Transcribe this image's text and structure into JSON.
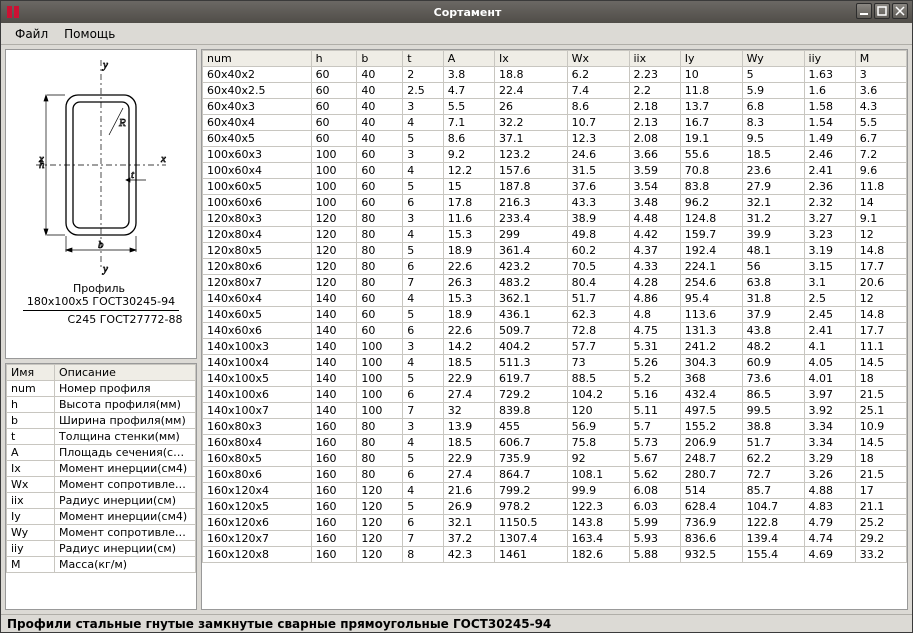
{
  "window": {
    "title": "Сортамент"
  },
  "menu": {
    "file": "Файл",
    "help": "Помощь"
  },
  "profile": {
    "prefix": "Профиль",
    "top_line": "180x100x5 ГОСТ30245-94",
    "bottom_line": "С245 ГОСТ27772-88"
  },
  "legend": {
    "columns": [
      "Имя",
      "Описание"
    ],
    "rows": [
      [
        "num",
        "Номер профиля"
      ],
      [
        "h",
        "Высота профиля(мм)"
      ],
      [
        "b",
        "Ширина профиля(мм)"
      ],
      [
        "t",
        "Толщина стенки(мм)"
      ],
      [
        "A",
        "Площадь сечения(с…"
      ],
      [
        "Ix",
        "Момент инерции(см4)"
      ],
      [
        "Wx",
        "Момент сопротивле…"
      ],
      [
        "iix",
        "Радиус инерции(см)"
      ],
      [
        "Iy",
        "Момент инерции(см4)"
      ],
      [
        "Wy",
        "Момент сопротивле…"
      ],
      [
        "iiy",
        "Радиус инерции(см)"
      ],
      [
        "M",
        "Масса(кг/м)"
      ]
    ]
  },
  "table": {
    "columns": [
      "num",
      "h",
      "b",
      "t",
      "A",
      "Ix",
      "Wx",
      "iix",
      "Iy",
      "Wy",
      "iiy",
      "M"
    ],
    "rows": [
      [
        "60x40x2",
        "60",
        "40",
        "2",
        "3.8",
        "18.8",
        "6.2",
        "2.23",
        "10",
        "5",
        "1.63",
        "3"
      ],
      [
        "60x40x2.5",
        "60",
        "40",
        "2.5",
        "4.7",
        "22.4",
        "7.4",
        "2.2",
        "11.8",
        "5.9",
        "1.6",
        "3.6"
      ],
      [
        "60x40x3",
        "60",
        "40",
        "3",
        "5.5",
        "26",
        "8.6",
        "2.18",
        "13.7",
        "6.8",
        "1.58",
        "4.3"
      ],
      [
        "60x40x4",
        "60",
        "40",
        "4",
        "7.1",
        "32.2",
        "10.7",
        "2.13",
        "16.7",
        "8.3",
        "1.54",
        "5.5"
      ],
      [
        "60x40x5",
        "60",
        "40",
        "5",
        "8.6",
        "37.1",
        "12.3",
        "2.08",
        "19.1",
        "9.5",
        "1.49",
        "6.7"
      ],
      [
        "100x60x3",
        "100",
        "60",
        "3",
        "9.2",
        "123.2",
        "24.6",
        "3.66",
        "55.6",
        "18.5",
        "2.46",
        "7.2"
      ],
      [
        "100x60x4",
        "100",
        "60",
        "4",
        "12.2",
        "157.6",
        "31.5",
        "3.59",
        "70.8",
        "23.6",
        "2.41",
        "9.6"
      ],
      [
        "100x60x5",
        "100",
        "60",
        "5",
        "15",
        "187.8",
        "37.6",
        "3.54",
        "83.8",
        "27.9",
        "2.36",
        "11.8"
      ],
      [
        "100x60x6",
        "100",
        "60",
        "6",
        "17.8",
        "216.3",
        "43.3",
        "3.48",
        "96.2",
        "32.1",
        "2.32",
        "14"
      ],
      [
        "120x80x3",
        "120",
        "80",
        "3",
        "11.6",
        "233.4",
        "38.9",
        "4.48",
        "124.8",
        "31.2",
        "3.27",
        "9.1"
      ],
      [
        "120x80x4",
        "120",
        "80",
        "4",
        "15.3",
        "299",
        "49.8",
        "4.42",
        "159.7",
        "39.9",
        "3.23",
        "12"
      ],
      [
        "120x80x5",
        "120",
        "80",
        "5",
        "18.9",
        "361.4",
        "60.2",
        "4.37",
        "192.4",
        "48.1",
        "3.19",
        "14.8"
      ],
      [
        "120x80x6",
        "120",
        "80",
        "6",
        "22.6",
        "423.2",
        "70.5",
        "4.33",
        "224.1",
        "56",
        "3.15",
        "17.7"
      ],
      [
        "120x80x7",
        "120",
        "80",
        "7",
        "26.3",
        "483.2",
        "80.4",
        "4.28",
        "254.6",
        "63.8",
        "3.1",
        "20.6"
      ],
      [
        "140x60x4",
        "140",
        "60",
        "4",
        "15.3",
        "362.1",
        "51.7",
        "4.86",
        "95.4",
        "31.8",
        "2.5",
        "12"
      ],
      [
        "140x60x5",
        "140",
        "60",
        "5",
        "18.9",
        "436.1",
        "62.3",
        "4.8",
        "113.6",
        "37.9",
        "2.45",
        "14.8"
      ],
      [
        "140x60x6",
        "140",
        "60",
        "6",
        "22.6",
        "509.7",
        "72.8",
        "4.75",
        "131.3",
        "43.8",
        "2.41",
        "17.7"
      ],
      [
        "140x100x3",
        "140",
        "100",
        "3",
        "14.2",
        "404.2",
        "57.7",
        "5.31",
        "241.2",
        "48.2",
        "4.1",
        "11.1"
      ],
      [
        "140x100x4",
        "140",
        "100",
        "4",
        "18.5",
        "511.3",
        "73",
        "5.26",
        "304.3",
        "60.9",
        "4.05",
        "14.5"
      ],
      [
        "140x100x5",
        "140",
        "100",
        "5",
        "22.9",
        "619.7",
        "88.5",
        "5.2",
        "368",
        "73.6",
        "4.01",
        "18"
      ],
      [
        "140x100x6",
        "140",
        "100",
        "6",
        "27.4",
        "729.2",
        "104.2",
        "5.16",
        "432.4",
        "86.5",
        "3.97",
        "21.5"
      ],
      [
        "140x100x7",
        "140",
        "100",
        "7",
        "32",
        "839.8",
        "120",
        "5.11",
        "497.5",
        "99.5",
        "3.92",
        "25.1"
      ],
      [
        "160x80x3",
        "160",
        "80",
        "3",
        "13.9",
        "455",
        "56.9",
        "5.7",
        "155.2",
        "38.8",
        "3.34",
        "10.9"
      ],
      [
        "160x80x4",
        "160",
        "80",
        "4",
        "18.5",
        "606.7",
        "75.8",
        "5.73",
        "206.9",
        "51.7",
        "3.34",
        "14.5"
      ],
      [
        "160x80x5",
        "160",
        "80",
        "5",
        "22.9",
        "735.9",
        "92",
        "5.67",
        "248.7",
        "62.2",
        "3.29",
        "18"
      ],
      [
        "160x80x6",
        "160",
        "80",
        "6",
        "27.4",
        "864.7",
        "108.1",
        "5.62",
        "280.7",
        "72.7",
        "3.26",
        "21.5"
      ],
      [
        "160x120x4",
        "160",
        "120",
        "4",
        "21.6",
        "799.2",
        "99.9",
        "6.08",
        "514",
        "85.7",
        "4.88",
        "17"
      ],
      [
        "160x120x5",
        "160",
        "120",
        "5",
        "26.9",
        "978.2",
        "122.3",
        "6.03",
        "628.4",
        "104.7",
        "4.83",
        "21.1"
      ],
      [
        "160x120x6",
        "160",
        "120",
        "6",
        "32.1",
        "1150.5",
        "143.8",
        "5.99",
        "736.9",
        "122.8",
        "4.79",
        "25.2"
      ],
      [
        "160x120x7",
        "160",
        "120",
        "7",
        "37.2",
        "1307.4",
        "163.4",
        "5.93",
        "836.6",
        "139.4",
        "4.74",
        "29.2"
      ],
      [
        "160x120x8",
        "160",
        "120",
        "8",
        "42.3",
        "1461",
        "182.6",
        "5.88",
        "932.5",
        "155.4",
        "4.69",
        "33.2"
      ]
    ]
  },
  "status": "Профили стальные гнутые замкнутые сварные прямоугольные ГОСТ30245-94"
}
